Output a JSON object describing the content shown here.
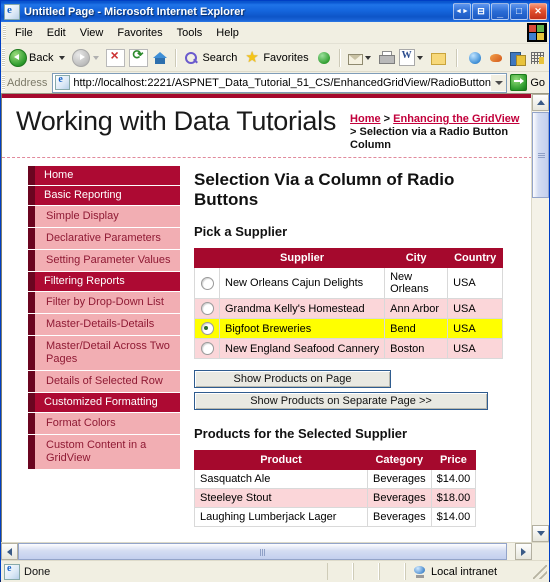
{
  "window": {
    "title": "Untitled Page - Microsoft Internet Explorer",
    "restore_glyph": "◄►",
    "group_glyph": "⊟",
    "minimize_glyph": "_",
    "maximize_glyph": "□",
    "close_glyph": "✕"
  },
  "menu": {
    "items": [
      "File",
      "Edit",
      "View",
      "Favorites",
      "Tools",
      "Help"
    ]
  },
  "toolbar": {
    "back_label": "Back",
    "search_label": "Search",
    "favorites_label": "Favorites"
  },
  "address": {
    "label": "Address",
    "url": "http://localhost:2221/ASPNET_Data_Tutorial_51_CS/EnhancedGridView/RadioButtonField.aspx",
    "go_label": "Go"
  },
  "page": {
    "site_title": "Working with Data Tutorials",
    "breadcrumb": {
      "home": "Home",
      "sep1": " > ",
      "section": "Enhancing the GridView",
      "current": " > Selection via a Radio Button Column"
    },
    "sidebar": [
      {
        "label": "Home",
        "type": "section"
      },
      {
        "label": "Basic Reporting",
        "type": "section"
      },
      {
        "label": "Simple Display",
        "type": "item"
      },
      {
        "label": "Declarative Parameters",
        "type": "item"
      },
      {
        "label": "Setting Parameter Values",
        "type": "item"
      },
      {
        "label": "Filtering Reports",
        "type": "section"
      },
      {
        "label": "Filter by Drop-Down List",
        "type": "item"
      },
      {
        "label": "Master-Details-Details",
        "type": "item"
      },
      {
        "label": "Master/Detail Across Two Pages",
        "type": "item"
      },
      {
        "label": "Details of Selected Row",
        "type": "item"
      },
      {
        "label": "Customized Formatting",
        "type": "section"
      },
      {
        "label": "Format Colors",
        "type": "item"
      },
      {
        "label": "Custom Content in a GridView",
        "type": "item"
      }
    ],
    "heading": "Selection Via a Column of Radio Buttons",
    "supplier_section_title": "Pick a Supplier",
    "supplier_table": {
      "headers": [
        "",
        "Supplier",
        "City",
        "Country"
      ],
      "rows": [
        {
          "selected": false,
          "supplier": "New Orleans Cajun Delights",
          "city": "New Orleans",
          "country": "USA"
        },
        {
          "selected": false,
          "supplier": "Grandma Kelly's Homestead",
          "city": "Ann Arbor",
          "country": "USA"
        },
        {
          "selected": true,
          "supplier": "Bigfoot Breweries",
          "city": "Bend",
          "country": "USA"
        },
        {
          "selected": false,
          "supplier": "New England Seafood Cannery",
          "city": "Boston",
          "country": "USA"
        }
      ]
    },
    "buttons": {
      "show_on_page": "Show Products on Page",
      "show_separate": "Show Products on Separate Page >>"
    },
    "products_section_title": "Products for the Selected Supplier",
    "products_table": {
      "headers": [
        "Product",
        "Category",
        "Price"
      ],
      "rows": [
        {
          "product": "Sasquatch Ale",
          "category": "Beverages",
          "price": "$14.00"
        },
        {
          "product": "Steeleye Stout",
          "category": "Beverages",
          "price": "$18.00"
        },
        {
          "product": "Laughing Lumberjack Lager",
          "category": "Beverages",
          "price": "$14.00"
        }
      ]
    }
  },
  "status": {
    "text": "Done",
    "zone": "Local intranet"
  },
  "colors": {
    "brand_dark": "#a5092d",
    "brand_accent": "#6b0520",
    "nav_item_bg": "#f2aeb3",
    "selected_row": "#ffff00",
    "alt_row": "#fbd6d9",
    "link": "#c2003b"
  }
}
